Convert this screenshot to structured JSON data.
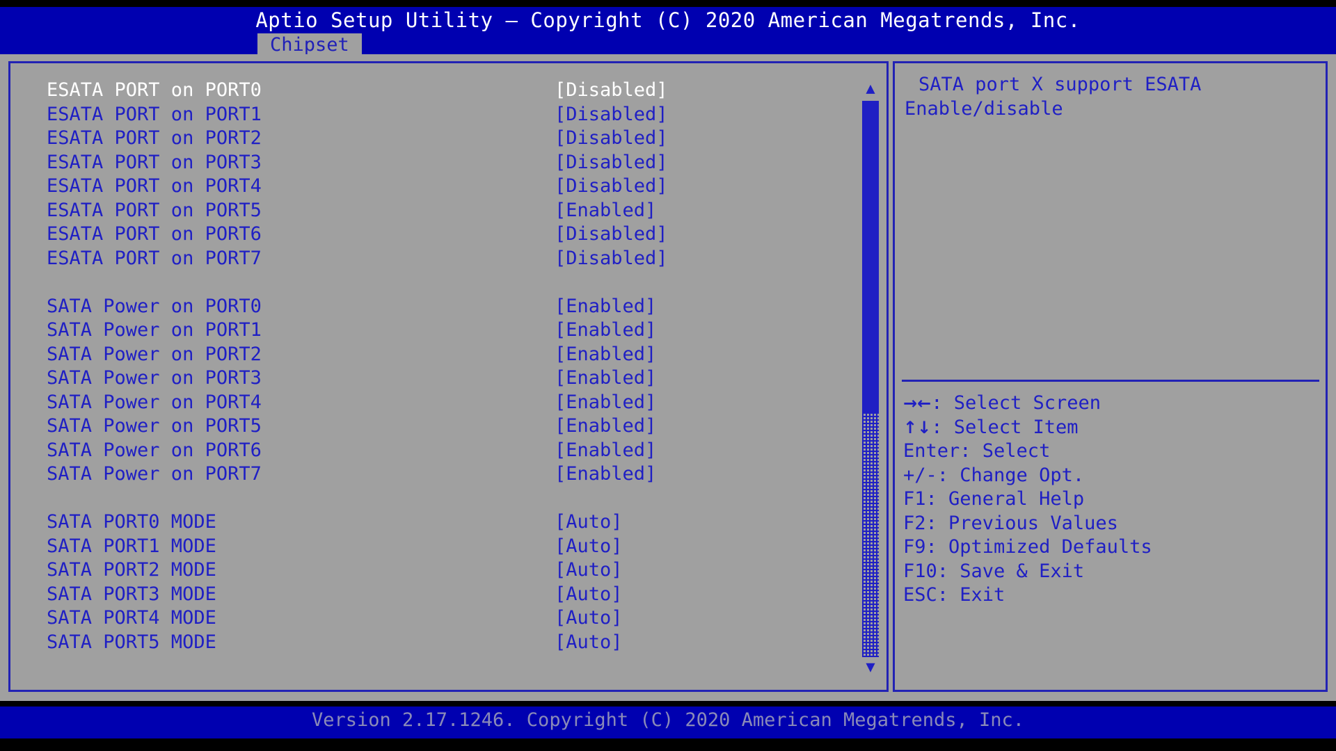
{
  "header": {
    "title": "Aptio Setup Utility – Copyright (C) 2020 American Megatrends, Inc.",
    "tabs": [
      {
        "label": "Chipset",
        "active": true
      }
    ]
  },
  "main": {
    "options": [
      {
        "label": "ESATA PORT on PORT0",
        "value": "[Disabled]",
        "selected": true
      },
      {
        "label": "ESATA PORT on PORT1",
        "value": "[Disabled]",
        "selected": false
      },
      {
        "label": "ESATA PORT on PORT2",
        "value": "[Disabled]",
        "selected": false
      },
      {
        "label": "ESATA PORT on PORT3",
        "value": "[Disabled]",
        "selected": false
      },
      {
        "label": "ESATA PORT on PORT4",
        "value": "[Disabled]",
        "selected": false
      },
      {
        "label": "ESATA PORT on PORT5",
        "value": "[Enabled]",
        "selected": false
      },
      {
        "label": "ESATA PORT on PORT6",
        "value": "[Disabled]",
        "selected": false
      },
      {
        "label": "ESATA PORT on PORT7",
        "value": "[Disabled]",
        "selected": false
      },
      {
        "spacer": true
      },
      {
        "label": "SATA Power on PORT0",
        "value": "[Enabled]",
        "selected": false
      },
      {
        "label": "SATA Power on PORT1",
        "value": "[Enabled]",
        "selected": false
      },
      {
        "label": "SATA Power on PORT2",
        "value": "[Enabled]",
        "selected": false
      },
      {
        "label": "SATA Power on PORT3",
        "value": "[Enabled]",
        "selected": false
      },
      {
        "label": "SATA Power on PORT4",
        "value": "[Enabled]",
        "selected": false
      },
      {
        "label": "SATA Power on PORT5",
        "value": "[Enabled]",
        "selected": false
      },
      {
        "label": "SATA Power on PORT6",
        "value": "[Enabled]",
        "selected": false
      },
      {
        "label": "SATA Power on PORT7",
        "value": "[Enabled]",
        "selected": false
      },
      {
        "spacer": true
      },
      {
        "label": "SATA PORT0 MODE",
        "value": "[Auto]",
        "selected": false
      },
      {
        "label": "SATA PORT1 MODE",
        "value": "[Auto]",
        "selected": false
      },
      {
        "label": "SATA PORT2 MODE",
        "value": "[Auto]",
        "selected": false
      },
      {
        "label": "SATA PORT3 MODE",
        "value": "[Auto]",
        "selected": false
      },
      {
        "label": "SATA PORT4 MODE",
        "value": "[Auto]",
        "selected": false
      },
      {
        "label": "SATA PORT5 MODE",
        "value": "[Auto]",
        "selected": false
      }
    ],
    "scrollbar": {
      "up_arrow": "▲",
      "down_arrow": "▼",
      "thumb_percent": 56
    }
  },
  "help": {
    "lines": [
      "SATA port X support ESATA",
      "Enable/disable"
    ]
  },
  "legend": {
    "items": [
      {
        "key": "→←",
        "text": ": Select Screen"
      },
      {
        "key": "↑↓",
        "text": ": Select Item"
      },
      {
        "key": "",
        "text": "Enter: Select"
      },
      {
        "key": "",
        "text": "+/-: Change Opt."
      },
      {
        "key": "",
        "text": "F1: General Help"
      },
      {
        "key": "",
        "text": "F2: Previous Values"
      },
      {
        "key": "",
        "text": "F9: Optimized Defaults"
      },
      {
        "key": "",
        "text": "F10: Save & Exit"
      },
      {
        "key": "",
        "text": "ESC: Exit"
      }
    ]
  },
  "footer": {
    "text": "Version 2.17.1246. Copyright (C) 2020 American Megatrends, Inc."
  },
  "colors": {
    "header_blue": "#0000b0",
    "body_gray": "#a0a0a0",
    "text_blue": "#1f1fc4",
    "border_blue": "#2222b4",
    "selected_text": "#ffffff",
    "footer_text": "#8a8ab8"
  }
}
